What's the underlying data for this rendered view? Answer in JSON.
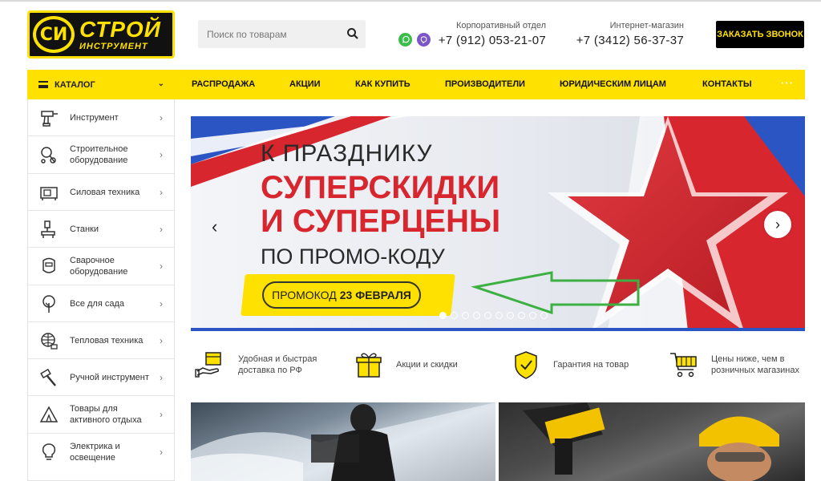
{
  "header": {
    "logo_top": "СТРОЙ",
    "logo_bottom": "ИНСТРУМЕНТ",
    "logo_mark": "СИ",
    "search_placeholder": "Поиск по товарам",
    "corp_label": "Корпоративный отдел",
    "corp_phone": "+7 (912) 053-21-07",
    "shop_label": "Интернет-магазин",
    "shop_phone": "+7 (3412) 56-37-37",
    "callback_label": "ЗАКАЗАТЬ ЗВОНОК",
    "messengers": [
      {
        "icon": "whatsapp-icon",
        "color": "#3cbc4b"
      },
      {
        "icon": "viber-icon",
        "color": "#7a56c8"
      }
    ]
  },
  "nav": {
    "catalog_label": "КАТАЛОГ",
    "items": [
      "РАСПРОДАЖА",
      "АКЦИИ",
      "КАК КУПИТЬ",
      "ПРОИЗВОДИТЕЛИ",
      "ЮРИДИЧЕСКИМ ЛИЦАМ",
      "КОНТАКТЫ"
    ],
    "more": "···"
  },
  "sidebar": {
    "items": [
      {
        "label": "Инструмент",
        "icon": "drill-icon"
      },
      {
        "label": "Строительное оборудование",
        "icon": "cement-mixer-icon"
      },
      {
        "label": "Силовая техника",
        "icon": "generator-icon"
      },
      {
        "label": "Станки",
        "icon": "machine-tool-icon"
      },
      {
        "label": "Сварочное оборудование",
        "icon": "welding-mask-icon"
      },
      {
        "label": "Все для сада",
        "icon": "tree-icon"
      },
      {
        "label": "Тепловая техника",
        "icon": "heater-icon"
      },
      {
        "label": "Ручной инструмент",
        "icon": "hammer-icon"
      },
      {
        "label": "Товары для активного отдыха",
        "icon": "tent-icon"
      },
      {
        "label": "Электрика и освещение",
        "icon": "lightbulb-icon"
      }
    ]
  },
  "banner": {
    "line1": "К ПРАЗДНИКУ",
    "line2": "СУПЕРСКИДКИ",
    "line3": "И СУПЕРЦЕНЫ",
    "line4": "ПО ПРОМО-КОДУ",
    "promo_prefix": "ПРОМОКОД",
    "promo_code": "23 ФЕВРАЛЯ",
    "slide_count": 10,
    "active_slide": 1
  },
  "features": [
    {
      "label": "Удобная и быстрая доставка по РФ",
      "icon": "delivery-box-icon"
    },
    {
      "label": "Акции и скидки",
      "icon": "gift-icon"
    },
    {
      "label": "Гарантия на товар",
      "icon": "shield-check-icon"
    },
    {
      "label": "Цены ниже, чем в розничных магазинах",
      "icon": "cart-icon"
    }
  ],
  "colors": {
    "brand_yellow": "#ffe100",
    "promo_red": "#d8262e",
    "annotation_green": "#3cb043"
  }
}
